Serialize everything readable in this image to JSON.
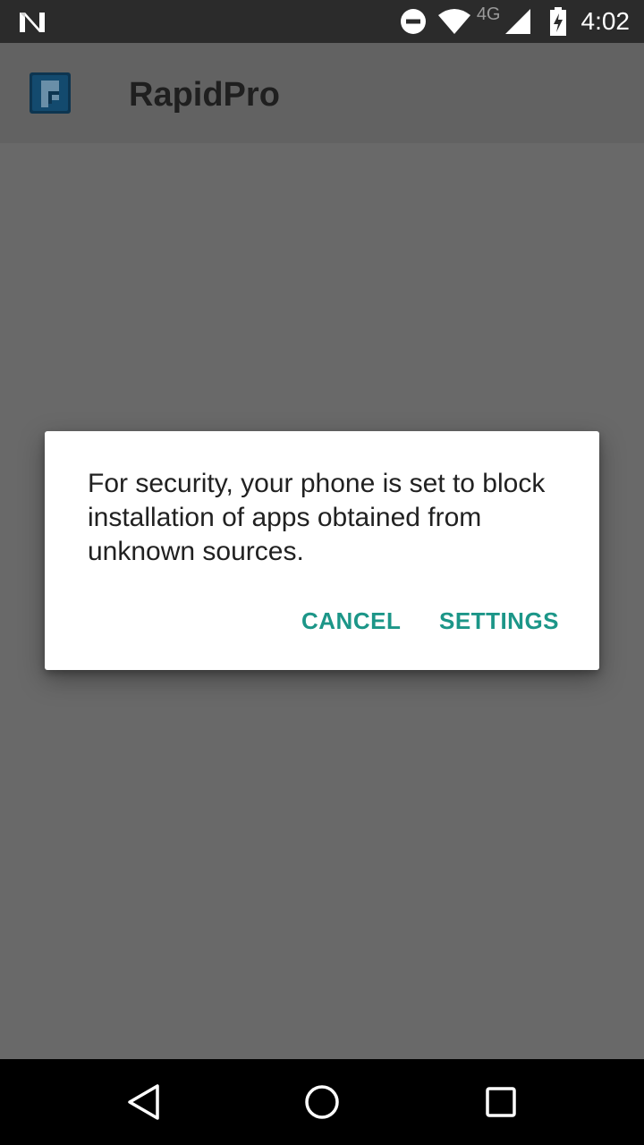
{
  "status_bar": {
    "network_type": "4G",
    "time": "4:02",
    "icons": [
      "n-logo-icon",
      "do-not-disturb-icon",
      "wifi-icon",
      "cell-signal-icon",
      "battery-charging-icon"
    ]
  },
  "app_bar": {
    "title": "RapidPro",
    "icon": "rapidpro-app-icon"
  },
  "dialog": {
    "message": "For security, your phone is set to block installation of apps obtained from unknown sources.",
    "cancel_label": "CANCEL",
    "settings_label": "SETTINGS",
    "accent_color": "#1c9688"
  },
  "nav_bar": {
    "icons": [
      "back-icon",
      "home-icon",
      "recents-icon"
    ]
  }
}
